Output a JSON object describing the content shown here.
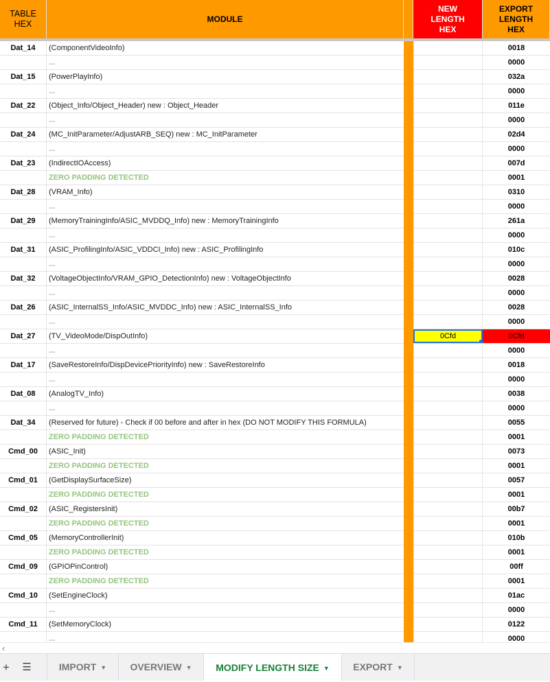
{
  "header": {
    "col_table": "TABLE\nHEX",
    "col_module": "MODULE",
    "col_new": "NEW\nLENGTH\nHEX",
    "col_export": "EXPORT\nLENGTH\nHEX"
  },
  "rows": [
    {
      "table": "Dat_14",
      "module": "(ComponentVideoInfo)",
      "new": "",
      "export": "0018"
    },
    {
      "table": "",
      "module": "...",
      "new": "",
      "export": "0000"
    },
    {
      "table": "Dat_15",
      "module": "(PowerPlayInfo)",
      "new": "",
      "export": "032a"
    },
    {
      "table": "",
      "module": "...",
      "new": "",
      "export": "0000"
    },
    {
      "table": "Dat_22",
      "module": "(Object_Info/Object_Header) new : Object_Header",
      "new": "",
      "export": "011e"
    },
    {
      "table": "",
      "module": "...",
      "new": "",
      "export": "0000"
    },
    {
      "table": "Dat_24",
      "module": "(MC_InitParameter/AdjustARB_SEQ) new : MC_InitParameter",
      "new": "",
      "export": "02d4"
    },
    {
      "table": "",
      "module": "...",
      "new": "",
      "export": "0000"
    },
    {
      "table": "Dat_23",
      "module": "(IndirectIOAccess)",
      "new": "",
      "export": "007d"
    },
    {
      "table": "",
      "module": "ZERO PADDING DETECTED",
      "new": "",
      "export": "0001"
    },
    {
      "table": "Dat_28",
      "module": "(VRAM_Info)",
      "new": "",
      "export": "0310"
    },
    {
      "table": "",
      "module": "...",
      "new": "",
      "export": "0000"
    },
    {
      "table": "Dat_29",
      "module": "(MemoryTrainingInfo/ASIC_MVDDQ_Info) new : MemoryTrainingInfo",
      "new": "",
      "export": "261a"
    },
    {
      "table": "",
      "module": "...",
      "new": "",
      "export": "0000"
    },
    {
      "table": "Dat_31",
      "module": "(ASIC_ProfilingInfo/ASIC_VDDCI_Info) new : ASIC_ProfilingInfo",
      "new": "",
      "export": "010c"
    },
    {
      "table": "",
      "module": "...",
      "new": "",
      "export": "0000"
    },
    {
      "table": "Dat_32",
      "module": "(VoltageObjectInfo/VRAM_GPIO_DetectionInfo) new : VoltageObjectInfo",
      "new": "",
      "export": "0028"
    },
    {
      "table": "",
      "module": "...",
      "new": "",
      "export": "0000"
    },
    {
      "table": "Dat_26",
      "module": "(ASIC_InternalSS_Info/ASIC_MVDDC_Info) new : ASIC_InternalSS_Info",
      "new": "",
      "export": "0028"
    },
    {
      "table": "",
      "module": "...",
      "new": "",
      "export": "0000"
    },
    {
      "table": "Dat_27",
      "module": "(TV_VideoMode/DispOutInfo)",
      "new": "0Cfd",
      "export": "0Cfd"
    },
    {
      "table": "",
      "module": "...",
      "new": "",
      "export": "0000"
    },
    {
      "table": "Dat_17",
      "module": "(SaveRestoreInfo/DispDevicePriorityInfo) new : SaveRestoreInfo",
      "new": "",
      "export": "0018"
    },
    {
      "table": "",
      "module": "...",
      "new": "",
      "export": "0000"
    },
    {
      "table": "Dat_08",
      "module": "(AnalogTV_Info)",
      "new": "",
      "export": "0038"
    },
    {
      "table": "",
      "module": "...",
      "new": "",
      "export": "0000"
    },
    {
      "table": "Dat_34",
      "module": "(Reserved for future) - Check if 00 before and after in hex  (DO NOT MODIFY THIS FORMULA)",
      "new": "",
      "export": "0055"
    },
    {
      "table": "",
      "module": "ZERO PADDING DETECTED",
      "new": "",
      "export": "0001"
    },
    {
      "table": "Cmd_00",
      "module": "(ASIC_Init)",
      "new": "",
      "export": "0073"
    },
    {
      "table": "",
      "module": "ZERO PADDING DETECTED",
      "new": "",
      "export": "0001"
    },
    {
      "table": "Cmd_01",
      "module": "(GetDisplaySurfaceSize)",
      "new": "",
      "export": "0057"
    },
    {
      "table": "",
      "module": "ZERO PADDING DETECTED",
      "new": "",
      "export": "0001"
    },
    {
      "table": "Cmd_02",
      "module": "(ASIC_RegistersInit)",
      "new": "",
      "export": "00b7"
    },
    {
      "table": "",
      "module": "ZERO PADDING DETECTED",
      "new": "",
      "export": "0001"
    },
    {
      "table": "Cmd_05",
      "module": "(MemoryControllerInit)",
      "new": "",
      "export": "010b"
    },
    {
      "table": "",
      "module": "ZERO PADDING DETECTED",
      "new": "",
      "export": "0001"
    },
    {
      "table": "Cmd_09",
      "module": "(GPIOPinControl)",
      "new": "",
      "export": "00ff"
    },
    {
      "table": "",
      "module": "ZERO PADDING DETECTED",
      "new": "",
      "export": "0001"
    },
    {
      "table": "Cmd_10",
      "module": "(SetEngineClock)",
      "new": "",
      "export": "01ac"
    },
    {
      "table": "",
      "module": "...",
      "new": "",
      "export": "0000"
    },
    {
      "table": "Cmd_11",
      "module": "(SetMemoryClock)",
      "new": "",
      "export": "0122"
    },
    {
      "table": "",
      "module": "...",
      "new": "",
      "export": "0000"
    }
  ],
  "selected_row": 20,
  "colors": {
    "header_orange": "#ff9900",
    "header_red": "#ff0000",
    "padding_green": "#93c47d",
    "selected_yellow": "#ffff00",
    "selection_blue": "#1a73e8",
    "active_tab_green": "#188038"
  },
  "footer": {
    "add_icon": "plus-icon",
    "menu_icon": "hamburger-icon",
    "scroll_icon": "chevron-left-icon",
    "tabs": [
      {
        "label": "IMPORT",
        "active": false
      },
      {
        "label": "OVERVIEW",
        "active": false
      },
      {
        "label": "MODIFY LENGTH SIZE",
        "active": true
      },
      {
        "label": "EXPORT",
        "active": false
      }
    ]
  }
}
